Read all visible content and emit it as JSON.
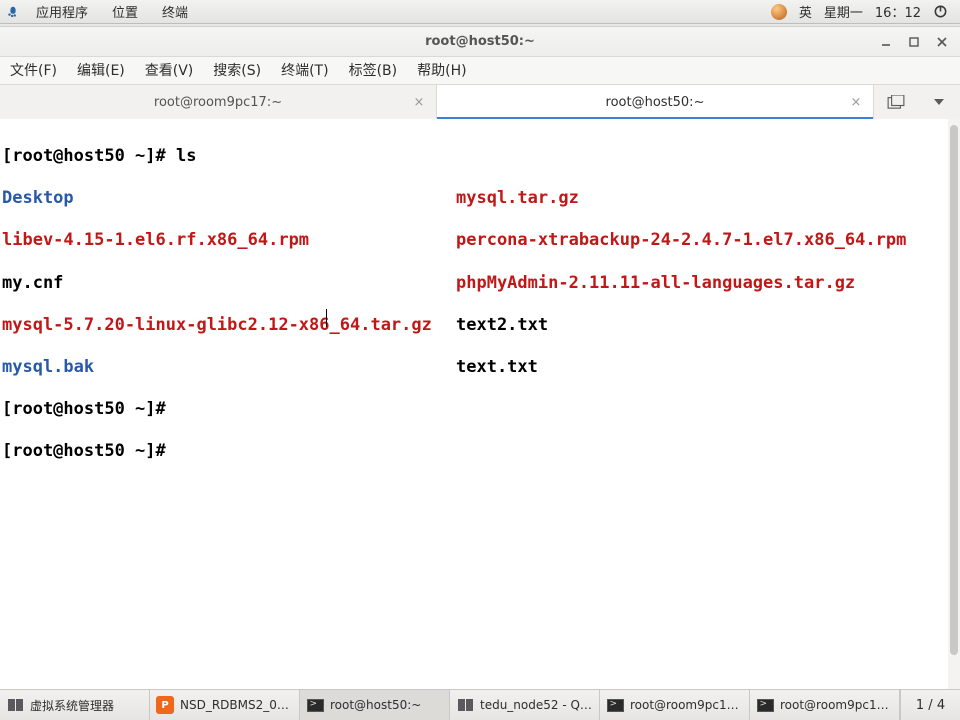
{
  "panel": {
    "apps_label": "应用程序",
    "places_label": "位置",
    "terminal_label": "终端",
    "ime": "英",
    "day": "星期一",
    "time": "16：12"
  },
  "window": {
    "title": "root@host50:~"
  },
  "menubar": {
    "file": "文件(F)",
    "edit": "编辑(E)",
    "view": "查看(V)",
    "search": "搜索(S)",
    "terminal": "终端(T)",
    "tabs": "标签(B)",
    "help": "帮助(H)"
  },
  "tabs": {
    "left": "root@room9pc17:~",
    "right": "root@host50:~"
  },
  "terminal": {
    "prompt1_a": "[root@host50 ~]# ",
    "prompt1_cmd": "ls",
    "line_desktop": "Desktop",
    "line_libev": "libev-4.15-1.el6.rf.x86_64.rpm",
    "line_mycnf": "my.cnf",
    "line_mysql_tgz": "mysql-5.7.20-linux-glibc2.12-x86_64.tar.gz",
    "line_mysqlbak": "mysql.bak",
    "col2_mysql_tgz": "mysql.tar.gz",
    "col2_percona": "percona-xtrabackup-24-2.4.7-1.el7.x86_64.rpm",
    "col2_phpmyadmin": "phpMyAdmin-2.11.11-all-languages.tar.gz",
    "col2_text2": "text2.txt",
    "col2_text": "text.txt",
    "prompt2": "[root@host50 ~]# ",
    "prompt3": "[root@host50 ~]# "
  },
  "taskbar": {
    "items": [
      {
        "icon": "monitors",
        "label": "虚拟系统管理器"
      },
      {
        "icon": "orange",
        "label": "NSD_RDBMS2_0…"
      },
      {
        "icon": "terminal",
        "label": "root@host50:~"
      },
      {
        "icon": "monitors",
        "label": "tedu_node52 - Q…"
      },
      {
        "icon": "terminal",
        "label": "root@room9pc1…"
      },
      {
        "icon": "terminal",
        "label": "root@room9pc1…"
      }
    ],
    "workspace": "1 / 4"
  }
}
